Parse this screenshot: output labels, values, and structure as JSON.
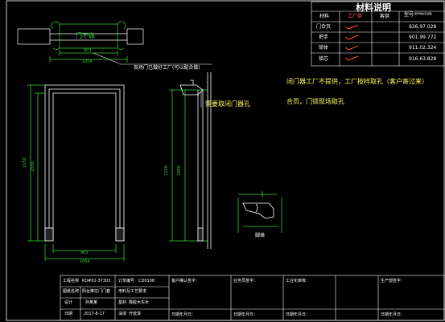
{
  "door_label": "门不做",
  "mat_table": {
    "title": "材料说明",
    "headers": [
      "材料",
      "工厂供",
      "客供",
      "型号"
    ],
    "model_header_note": "(型号规格见说明)",
    "rows": [
      {
        "name": "门合页",
        "model": "926.97.028"
      },
      {
        "name": "把手",
        "model": "901.99.772"
      },
      {
        "name": "锁体",
        "model": "911.02.324"
      },
      {
        "name": "锁芯",
        "model": "916.63.828"
      }
    ]
  },
  "dims": {
    "top_width": "903",
    "top_total": "1054",
    "bottom_width": "903",
    "bottom_total": "1054",
    "left_outer": "2150",
    "left_inner": "2050",
    "right_a": "2150",
    "right_b": "2050"
  },
  "annotations": {
    "site_note": "现场门已做好工厂(可以配合做)",
    "lock_hole_note": "需要取闭门器孔",
    "closer_note": "闭门器工厂不提供，工厂按样取孔（客户寄过来）",
    "hinge_note": "合页，门锁现场取孔",
    "profile_label": "脚墩"
  },
  "title_block": {
    "col1": [
      {
        "label": "工程名称",
        "value": "KD#01-37303"
      },
      {
        "label": "图纸名称",
        "value": "阳台推拉门门套"
      },
      {
        "label": "设计",
        "value": "孙某某"
      },
      {
        "label": "日期",
        "value": "2017-8-17"
      }
    ],
    "col2": [
      {
        "label": "订单编号",
        "value": "CD0108"
      },
      {
        "label": "用料及工艺要求",
        "value": ""
      },
      {
        "label": "基材",
        "value": "橡胶木实木"
      },
      {
        "label": "油漆",
        "value": "开放漆"
      }
    ],
    "sign_cols": [
      {
        "top": "客户确认签字：",
        "bottom": "日期年月日："
      },
      {
        "top": "业务员签字：",
        "bottom": "日期年月日："
      },
      {
        "top": "工业化审核：",
        "bottom": "日期年月日："
      },
      {
        "top": "生产部签字：",
        "bottom": "日期年月日："
      }
    ]
  }
}
